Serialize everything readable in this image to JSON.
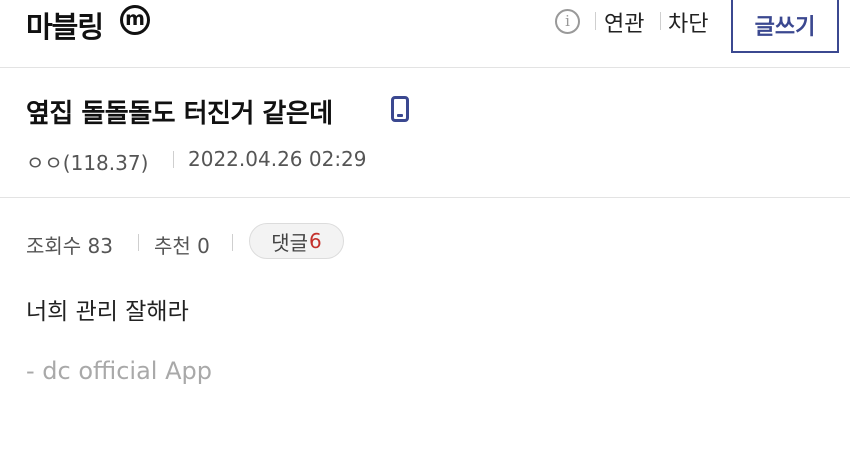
{
  "header": {
    "gallery_name": "마블링",
    "minor_badge": "m",
    "info_icon": "info-icon",
    "related_label": "연관",
    "block_label": "차단",
    "write_label": "글쓰기"
  },
  "post": {
    "title": "옆집 돌돌돌도 터진거 같은데",
    "device_icon": "mobile-icon",
    "author": "ㅇㅇ(118.37)",
    "datetime": "2022.04.26 02:29",
    "views": "조회수 83",
    "recommend": "추천 0",
    "comment_label": "댓글",
    "comment_count": "6",
    "body": "너희 관리 잘해라",
    "signature": "- dc official App"
  },
  "colors": {
    "accent": "#3b4890",
    "comment_count": "#c4302b",
    "muted_text": "#a9a9a9"
  }
}
